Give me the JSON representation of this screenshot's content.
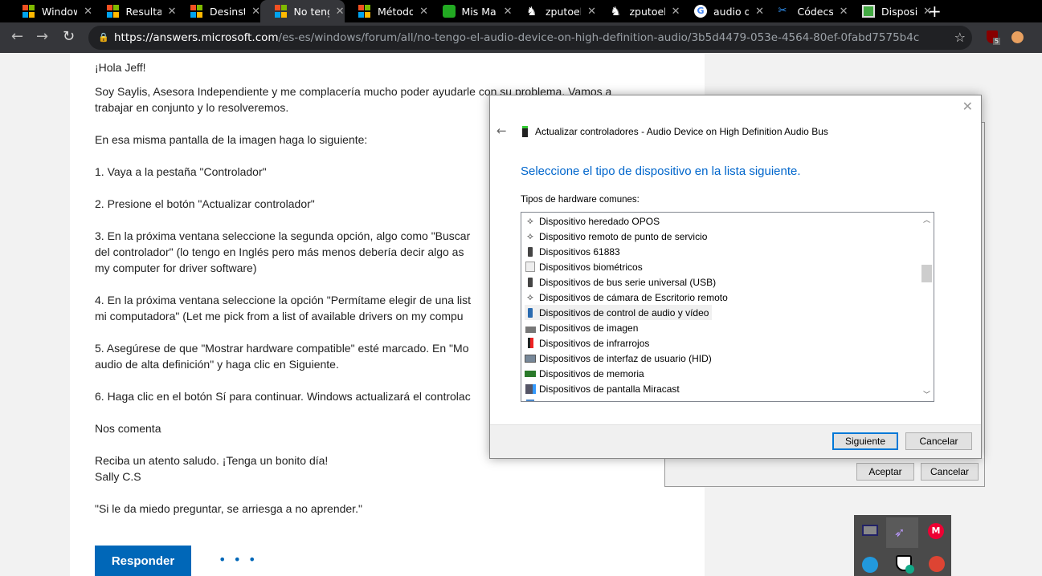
{
  "browser": {
    "tabs": [
      {
        "title": "Windows",
        "icon": "microsoft-icon"
      },
      {
        "title": "Resultados",
        "icon": "microsoft-icon"
      },
      {
        "title": "Desinstalar",
        "icon": "microsoft-icon"
      },
      {
        "title": "No tengo",
        "icon": "microsoft-icon",
        "active": true
      },
      {
        "title": "Método",
        "icon": "microsoft-icon"
      },
      {
        "title": "Mis Ma",
        "icon": "green-app-icon"
      },
      {
        "title": "zputoel",
        "icon": "chess-knight-icon"
      },
      {
        "title": "zputoel",
        "icon": "chess-knight-icon"
      },
      {
        "title": "audio d",
        "icon": "google-icon"
      },
      {
        "title": "Códecs",
        "icon": "codec-icon"
      },
      {
        "title": "Dispositivos",
        "icon": "image-icon"
      }
    ],
    "new_tab": "+",
    "url_host": "https://answers.microsoft.com",
    "url_path": "/es-es/windows/forum/all/no-tengo-el-audio-device-on-high-definition-audio/3b5d4479-053e-4564-80ef-0fabd7575b4c",
    "extension_badge": "5"
  },
  "post": {
    "lines": [
      "¡Hola Jeff!",
      "Soy Saylis, Asesora Independiente y me complacería mucho poder ayudarle con su problema. Vamos a",
      "trabajar en conjunto y lo resolveremos.",
      "En esa misma pantalla de la imagen haga lo siguiente:",
      "1. Vaya a la pestaña \"Controlador\"",
      "2. Presione el botón \"Actualizar controlador\"",
      "3. En la próxima ventana seleccione la segunda opción, algo como \"Buscar",
      "del controlador\" (lo tengo en Inglés pero más menos debería decir algo as",
      "my computer for driver software)",
      "4. En la próxima ventana seleccione la opción \"Permítame elegir de una list",
      "mi computadora\" (Let me pick from a list of available drivers on my compu",
      "5. Asegúrese de que \"Mostrar hardware compatible\" esté marcado. En \"Mo",
      "audio de alta definición\" y haga clic en Siguiente.",
      "6. Haga clic en el botón Sí para continuar. Windows actualizará el controlac",
      "Nos comenta",
      "Reciba un atento saludo. ¡Tenga un bonito día!",
      "Sally C.S",
      "\"Si le da miedo preguntar, se arriesga a no aprender.\""
    ],
    "reply_label": "Responder",
    "more_label": "• • •"
  },
  "dialog": {
    "title": "Actualizar controladores - Audio Device on High Definition Audio Bus",
    "heading": "Seleccione el tipo de dispositivo en la lista siguiente.",
    "list_label": "Tipos de hardware comunes:",
    "items": [
      {
        "label": "Dispositivo heredado OPOS",
        "icon": "pos-device-icon"
      },
      {
        "label": "Dispositivo remoto de punto de servicio",
        "icon": "pos-device-icon"
      },
      {
        "label": "Dispositivos 61883",
        "icon": "usb-plug-icon"
      },
      {
        "label": "Dispositivos biométricos",
        "icon": "fingerprint-icon"
      },
      {
        "label": "Dispositivos de bus serie universal (USB)",
        "icon": "usb-plug-icon"
      },
      {
        "label": "Dispositivos de cámara de Escritorio remoto",
        "icon": "pos-device-icon"
      },
      {
        "label": "Dispositivos de control de audio y vídeo",
        "icon": "av-control-icon",
        "highlighted": true
      },
      {
        "label": "Dispositivos de imagen",
        "icon": "scanner-icon"
      },
      {
        "label": "Dispositivos de infrarrojos",
        "icon": "infrared-icon"
      },
      {
        "label": "Dispositivos de interfaz de usuario (HID)",
        "icon": "keyboard-icon"
      },
      {
        "label": "Dispositivos de memoria",
        "icon": "memory-icon"
      },
      {
        "label": "Dispositivos de pantalla Miracast",
        "icon": "miracast-icon"
      }
    ],
    "next_label": "Siguiente",
    "cancel_label": "Cancelar",
    "accent": "#0066cc"
  },
  "behind_dialog": {
    "ok_label": "Aceptar",
    "cancel_label": "Cancelar"
  },
  "tray": {
    "icons": [
      "display-icon",
      "feather-icon",
      "mega-icon",
      "network-app-icon",
      "defender-icon",
      "ccleaner-icon"
    ]
  }
}
